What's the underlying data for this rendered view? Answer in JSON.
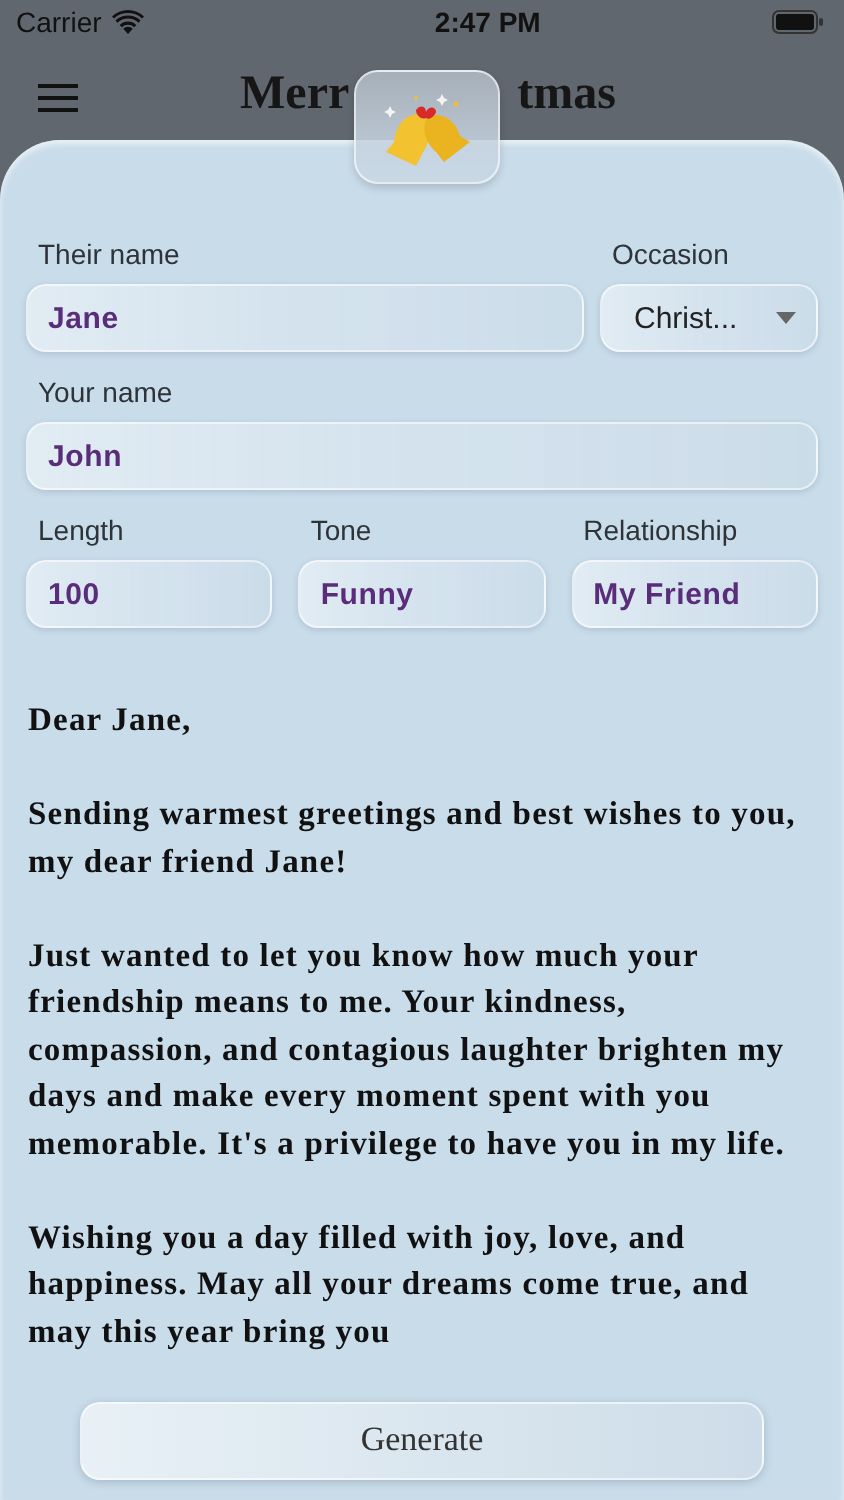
{
  "status_bar": {
    "carrier": "Carrier",
    "time": "2:47 PM"
  },
  "header": {
    "title_parts": [
      "Merr",
      "tmas"
    ]
  },
  "form": {
    "their_name": {
      "label": "Their name",
      "value": "Jane"
    },
    "occasion": {
      "label": "Occasion",
      "value": "Christ..."
    },
    "your_name": {
      "label": "Your name",
      "value": "John"
    },
    "length": {
      "label": "Length",
      "value": "100"
    },
    "tone": {
      "label": "Tone",
      "value": "Funny"
    },
    "relationship": {
      "label": "Relationship",
      "value": "My Friend"
    }
  },
  "letter": {
    "paragraphs": [
      "Dear Jane,",
      "Sending warmest greetings and best wishes to you, my dear friend Jane!",
      "Just wanted to let you know how much your friendship means to me. Your kindness, compassion, and contagious laughter brighten my days and make every moment spent with you memorable. It's a privilege to have you in my life.",
      "Wishing you a day filled with joy, love, and happiness. May all your dreams come true, and may this year bring you"
    ]
  },
  "generate_button": {
    "label": "Generate"
  }
}
